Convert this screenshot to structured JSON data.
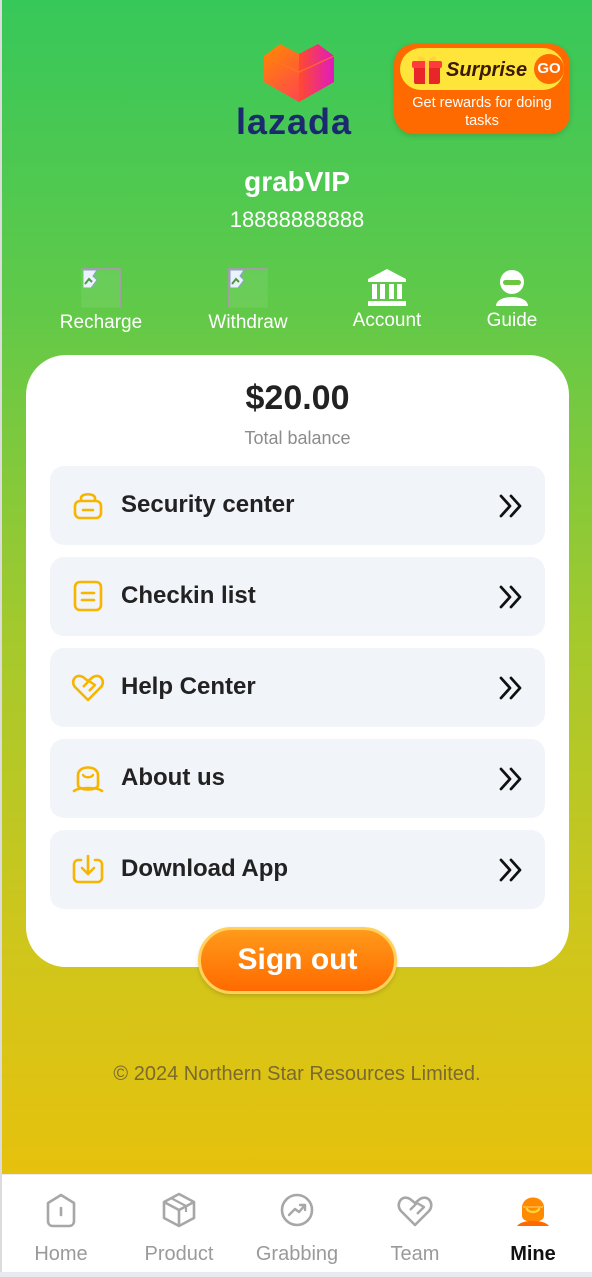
{
  "brand": {
    "logo_text": "lazada",
    "colors": {
      "green_top": "#37c85a",
      "yellow_bottom": "#e6c10d",
      "accent_orange": "#ff6a00"
    }
  },
  "promo": {
    "title": "Surprise",
    "go_label": "GO",
    "subtitle": "Get rewards for doing tasks",
    "icon": "gift-icon"
  },
  "user": {
    "name": "grabVIP",
    "phone": "18888888888"
  },
  "quick_actions": [
    {
      "label": "Recharge",
      "icon": "broken-image-icon"
    },
    {
      "label": "Withdraw",
      "icon": "broken-image-icon"
    },
    {
      "label": "Account",
      "icon": "bank-icon"
    },
    {
      "label": "Guide",
      "icon": "user-support-icon"
    }
  ],
  "balance": {
    "amount": "$20.00",
    "label": "Total balance"
  },
  "menu": [
    {
      "label": "Security center",
      "icon": "lock-icon"
    },
    {
      "label": "Checkin list",
      "icon": "list-icon"
    },
    {
      "label": "Help Center",
      "icon": "heart-handshake-icon"
    },
    {
      "label": "About us",
      "icon": "info-person-icon"
    },
    {
      "label": "Download App",
      "icon": "download-icon"
    }
  ],
  "signout_label": "Sign out",
  "copyright": "© 2024 Northern Star Resources Limited.",
  "tabs": [
    {
      "label": "Home",
      "icon": "home-icon",
      "active": false
    },
    {
      "label": "Product",
      "icon": "box-icon",
      "active": false
    },
    {
      "label": "Grabbing",
      "icon": "trend-icon",
      "active": false
    },
    {
      "label": "Team",
      "icon": "team-heart-icon",
      "active": false
    },
    {
      "label": "Mine",
      "icon": "mine-user-icon",
      "active": true
    }
  ]
}
